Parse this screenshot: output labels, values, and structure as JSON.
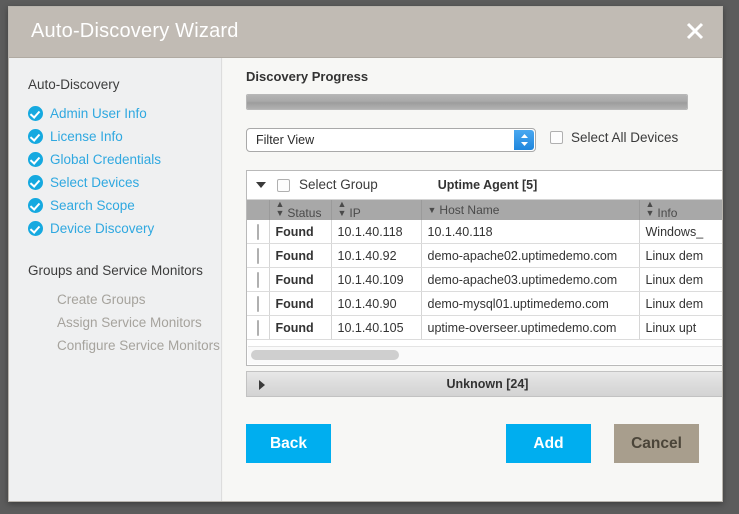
{
  "window": {
    "title": "Auto-Discovery Wizard",
    "close_icon": "close-icon"
  },
  "sidebar": {
    "section1_title": "Auto-Discovery",
    "completed_steps": [
      {
        "label": "Admin User Info",
        "icon": "check-circle-icon"
      },
      {
        "label": "License Info",
        "icon": "check-circle-icon"
      },
      {
        "label": "Global Credentials",
        "icon": "check-circle-icon"
      },
      {
        "label": "Select Devices",
        "icon": "check-circle-icon"
      },
      {
        "label": "Search Scope",
        "icon": "check-circle-icon"
      },
      {
        "label": "Device Discovery",
        "icon": "check-circle-icon"
      }
    ],
    "section2_title": "Groups and Service Monitors",
    "pending_steps": [
      {
        "label": "Create Groups"
      },
      {
        "label": "Assign Service Monitors"
      },
      {
        "label": "Configure Service Monitors"
      }
    ]
  },
  "main": {
    "progress_label": "Discovery Progress",
    "progress_percent": 100,
    "filter": {
      "selected": "Filter View",
      "stepper_icon": "chevron-up-down-icon"
    },
    "select_all": {
      "label": "Select All Devices",
      "checked": false
    },
    "group": {
      "disclosure_icon": "chevron-down-icon",
      "select_group_label": "Select Group",
      "select_group_checked": false,
      "title": "Uptime Agent [5]",
      "columns": [
        {
          "key": "check",
          "label": "",
          "sort_icon": ""
        },
        {
          "key": "status",
          "label": "Status",
          "sort_icon": "sort-updown-icon"
        },
        {
          "key": "ip",
          "label": "IP",
          "sort_icon": "sort-updown-icon"
        },
        {
          "key": "host",
          "label": "Host Name",
          "sort_icon": "sort-down-icon"
        },
        {
          "key": "info",
          "label": "Info",
          "sort_icon": "sort-updown-icon"
        }
      ],
      "rows": [
        {
          "checked": false,
          "status": "Found",
          "ip": "10.1.40.118",
          "host": "10.1.40.118",
          "info": "Windows_"
        },
        {
          "checked": false,
          "status": "Found",
          "ip": "10.1.40.92",
          "host": "demo-apache02.uptimedemo.com",
          "info": "Linux dem"
        },
        {
          "checked": false,
          "status": "Found",
          "ip": "10.1.40.109",
          "host": "demo-apache03.uptimedemo.com",
          "info": "Linux dem"
        },
        {
          "checked": false,
          "status": "Found",
          "ip": "10.1.40.90",
          "host": "demo-mysql01.uptimedemo.com",
          "info": "Linux dem"
        },
        {
          "checked": false,
          "status": "Found",
          "ip": "10.1.40.105",
          "host": "uptime-overseer.uptimedemo.com",
          "info": "Linux upt"
        }
      ],
      "hscroll_icon": "horizontal-scrollbar"
    },
    "unknown_group": {
      "disclosure_icon": "chevron-right-icon",
      "title": "Unknown [24]"
    }
  },
  "footer": {
    "back_label": "Back",
    "add_label": "Add",
    "cancel_label": "Cancel"
  },
  "colors": {
    "titlebar": "#c1bbb4",
    "accent_blue": "#00aeef",
    "step_blue": "#2fa8e0",
    "found_green": "#8cc63f",
    "cancel_tan": "#a89e8d",
    "sidebar_bg": "#eff0f1"
  }
}
